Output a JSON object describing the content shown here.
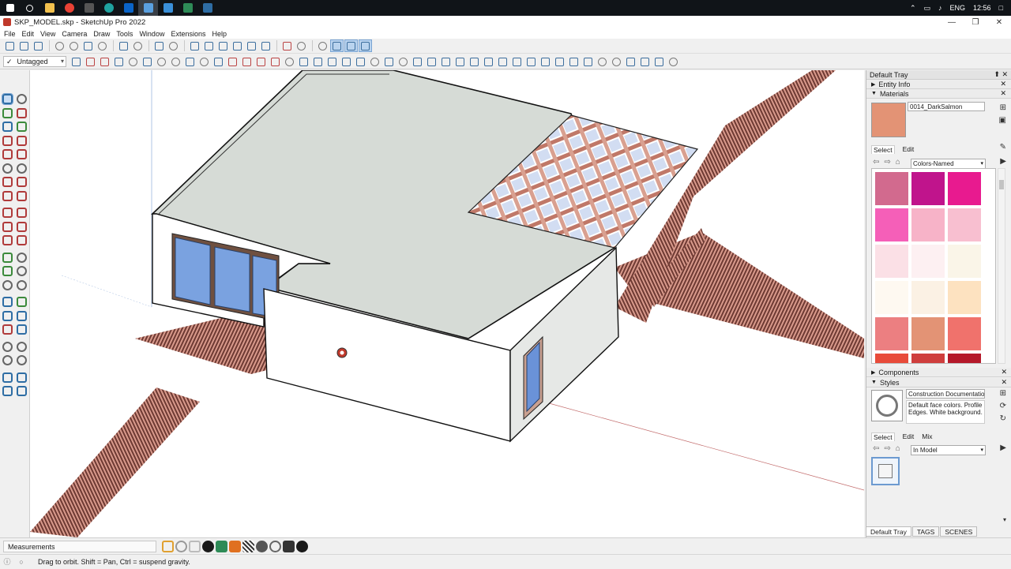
{
  "taskbar": {
    "icons": [
      "windows-start-icon",
      "search-icon",
      "file-explorer-icon",
      "chrome-icon",
      "calculator-icon",
      "edge-icon",
      "outlook-icon",
      "sketchup-icon",
      "sketchup-layout-icon",
      "download-icon",
      "app-icon"
    ],
    "language": "ENG",
    "time": "12:56"
  },
  "window": {
    "title": "SKP_MODEL.skp - SketchUp Pro 2022",
    "minimize": "—",
    "maximize": "❐",
    "close": "✕"
  },
  "menu": [
    "File",
    "Edit",
    "View",
    "Camera",
    "Draw",
    "Tools",
    "Window",
    "Extensions",
    "Help"
  ],
  "toolbar": {
    "tag_value": "Untagged",
    "tag_check": "✓"
  },
  "tray": {
    "title": "Default Tray",
    "pin": "⬆ ✕",
    "entity_info": "Entity Info",
    "materials": {
      "label": "Materials",
      "current_name": "0014_DarkSalmon",
      "current_color": "#e39375",
      "tab_select": "Select",
      "tab_edit": "Edit",
      "library": "Colors-Named",
      "swatches": [
        "#d26a8e",
        "#c0148c",
        "#e81a8f",
        "#f55fb8",
        "#f7b3c8",
        "#f8bfd0",
        "#fbe0e6",
        "#fdf0f2",
        "#faf5e8",
        "#fef9f1",
        "#fbf1e4",
        "#fde2c0",
        "#ec7f81",
        "#e39375",
        "#f0726c",
        "#e84b3a",
        "#cf3e3d",
        "#b5192a"
      ]
    },
    "components": "Components",
    "styles": {
      "label": "Styles",
      "name": "Construction Documentation S",
      "description": "Default face colors. Profile Edges. White background.",
      "tab_select": "Select",
      "tab_edit": "Edit",
      "tab_mix": "Mix",
      "collection": "In Model"
    },
    "bottom_tabs": [
      "Default Tray",
      "TAGS",
      "SCENES"
    ]
  },
  "measurements": {
    "label": "Measurements"
  },
  "status": {
    "text": "Drag to orbit. Shift = Pan, Ctrl = suspend gravity."
  }
}
